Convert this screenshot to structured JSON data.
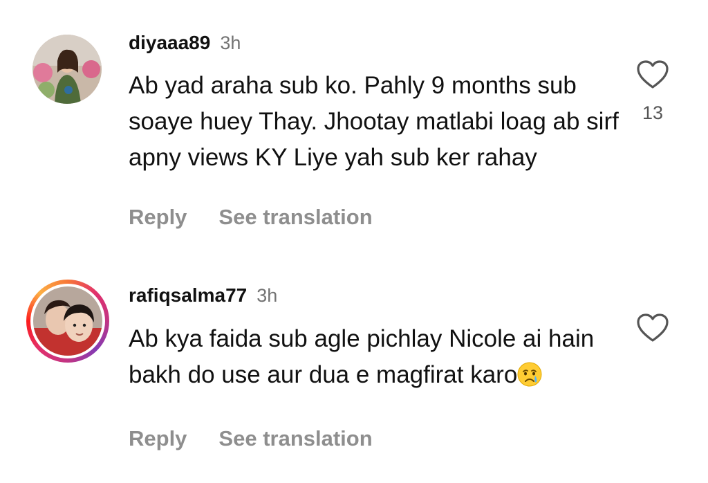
{
  "comments": [
    {
      "username": "diyaaa89",
      "time": "3h",
      "text": "Ab yad araha sub ko. Pahly 9 months sub soaye huey Thay. Jhootay matlabi loag ab sirf apny views KY Liye yah sub ker rahay",
      "like_count": "13",
      "reply_label": "Reply",
      "translate_label": "See translation",
      "has_story_ring": false
    },
    {
      "username": "rafiqsalma77",
      "time": "3h",
      "text": "Ab kya faida sub agle pichlay Nicole ai hain bakh do use aur dua e magfirat karo",
      "emoji": "crying-face-emoji",
      "like_count": "",
      "reply_label": "Reply",
      "translate_label": "See translation",
      "has_story_ring": true
    }
  ],
  "icons": {
    "like": "heart-outline-icon"
  },
  "colors": {
    "username": "#111111",
    "muted": "#737373",
    "action": "#8e8e8e",
    "story_ring_start": "#f77737",
    "story_ring_end": "#833ab4"
  }
}
